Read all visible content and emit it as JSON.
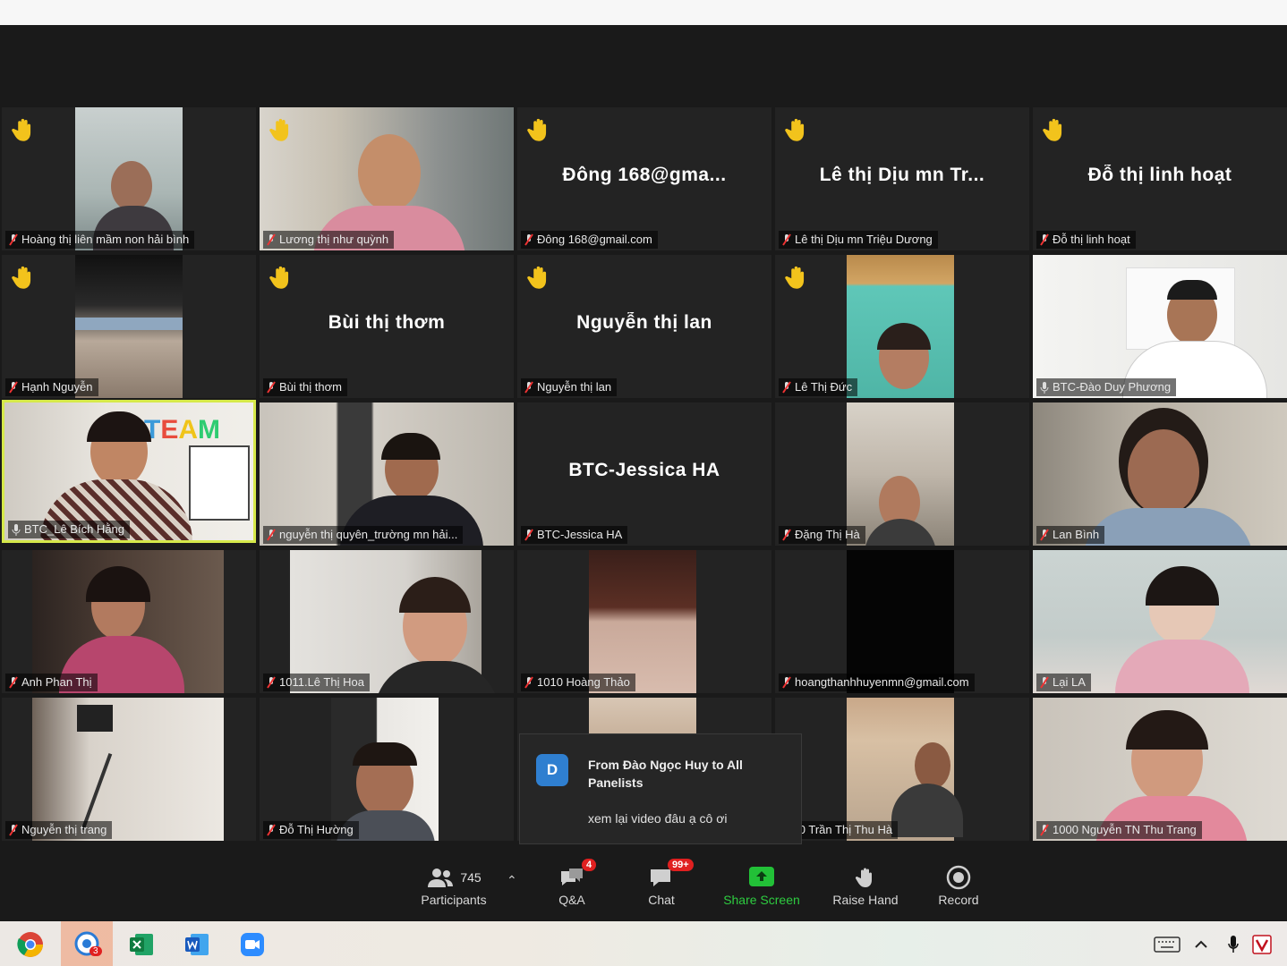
{
  "meeting": {
    "participants_label": "Participants",
    "participants_count": "745",
    "qa_label": "Q&A",
    "qa_badge": "4",
    "chat_label": "Chat",
    "chat_badge": "99+",
    "share_screen_label": "Share Screen",
    "raise_hand_label": "Raise Hand",
    "record_label": "Record"
  },
  "tiles": [
    {
      "name": "Hoàng thị liên mầm non hải bình",
      "big_name": "",
      "hand": true
    },
    {
      "name": "Lương thị như quỳnh",
      "big_name": "",
      "hand": true
    },
    {
      "name": "Đông 168@gmail.com",
      "big_name": "Đông 168@gma...",
      "hand": true
    },
    {
      "name": "Lê thị Dịu mn Triệu Dương",
      "big_name": "Lê thị Dịu mn Tr...",
      "hand": true
    },
    {
      "name": "Đỗ thị linh hoạt",
      "big_name": "Đỗ thị linh hoạt",
      "hand": true
    },
    {
      "name": "Hạnh Nguyễn",
      "big_name": "",
      "hand": true
    },
    {
      "name": "Bùi thị thơm",
      "big_name": "Bùi thị thơm",
      "hand": true
    },
    {
      "name": "Nguyễn thị lan",
      "big_name": "Nguyễn thị lan",
      "hand": true
    },
    {
      "name": "Lê Thị Đức",
      "big_name": "",
      "hand": true
    },
    {
      "name": "BTC-Đào Duy Phương",
      "big_name": "",
      "hand": false
    },
    {
      "name": "BTC_Lê Bích Hằng",
      "big_name": "",
      "hand": false
    },
    {
      "name": "nguyễn thị quyên_trường mn hải...",
      "big_name": "",
      "hand": false
    },
    {
      "name": "BTC-Jessica HA",
      "big_name": "BTC-Jessica HA",
      "hand": false
    },
    {
      "name": "Đặng Thị Hà",
      "big_name": "",
      "hand": false
    },
    {
      "name": "Lan Bình",
      "big_name": "",
      "hand": false
    },
    {
      "name": "Anh Phan Thị",
      "big_name": "",
      "hand": false
    },
    {
      "name": "1011.Lê Thị Hoa",
      "big_name": "",
      "hand": false
    },
    {
      "name": "1010 Hoàng Thảo",
      "big_name": "",
      "hand": false
    },
    {
      "name": "hoangthanhhuyenmn@gmail.com",
      "big_name": "",
      "hand": false
    },
    {
      "name": "Lại LA",
      "big_name": "",
      "hand": false
    },
    {
      "name": "Nguyễn thị trang",
      "big_name": "",
      "hand": false
    },
    {
      "name": "Đỗ Thị Hường",
      "big_name": "",
      "hand": false
    },
    {
      "name": "",
      "big_name": "",
      "hand": false
    },
    {
      "name": "0-10 Trần Thị Thu Hà",
      "big_name": "",
      "hand": false
    },
    {
      "name": "1000 Nguyễn TN Thu Trang",
      "big_name": "",
      "hand": false
    }
  ],
  "toast": {
    "avatar_letter": "D",
    "from": "From Đào Ngọc Huy to All Panelists",
    "message": "xem lại video đâu ạ cô ơi"
  },
  "taskbar": {
    "edge_badge": "3"
  }
}
